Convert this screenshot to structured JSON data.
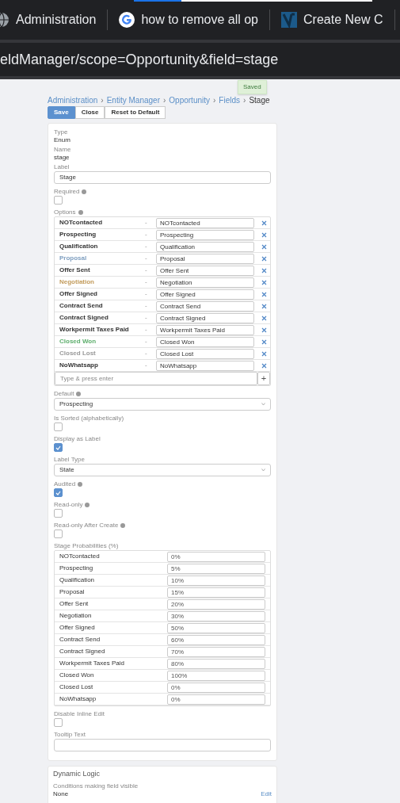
{
  "browser": {
    "tabs": [
      {
        "title": "Administration",
        "kind": "globe"
      },
      {
        "title": "how to remove all op",
        "kind": "google"
      },
      {
        "title": "Create New C",
        "kind": "logo"
      }
    ],
    "address": "eldManager/scope=Opportunity&field=stage"
  },
  "notification": "Saved",
  "breadcrumb": {
    "separator": "›",
    "items": [
      "Administration",
      "Entity Manager",
      "Opportunity",
      "Fields",
      "Stage"
    ]
  },
  "buttons": [
    {
      "label": "Save",
      "kind": "primary"
    },
    {
      "label": "Close",
      "kind": "default"
    },
    {
      "label": "Reset to Default",
      "kind": "default"
    }
  ],
  "fields": [
    {
      "kind": "static",
      "label": "Type",
      "value": "Enum"
    },
    {
      "kind": "static",
      "label": "Name",
      "value": "stage"
    },
    {
      "kind": "text",
      "label": "Label",
      "value": "Stage"
    },
    {
      "kind": "checkbox",
      "label": "Required",
      "info": true,
      "checked": false
    },
    {
      "kind": "options",
      "label": "Options",
      "info": true,
      "separator": "-",
      "placeholder": "Type & press enter",
      "add": "+",
      "items": [
        {
          "label": "NOTcontacted",
          "value": "NOTcontacted",
          "color": "#333333"
        },
        {
          "label": "Prospecting",
          "value": "Prospecting",
          "color": "#333333"
        },
        {
          "label": "Qualification",
          "value": "Qualification",
          "color": "#333333"
        },
        {
          "label": "Proposal",
          "value": "Proposal",
          "color": "#7f9fc0"
        },
        {
          "label": "Offer Sent",
          "value": "Offer Sent",
          "color": "#333333"
        },
        {
          "label": "Negotiation",
          "value": "Negotiation",
          "color": "#c29b5b"
        },
        {
          "label": "Offer Signed",
          "value": "Offer Signed",
          "color": "#333333"
        },
        {
          "label": "Contract Send",
          "value": "Contract Send",
          "color": "#333333"
        },
        {
          "label": "Contract Signed",
          "value": "Contract Signed",
          "color": "#333333"
        },
        {
          "label": "Workpermit Taxes Paid",
          "value": "Workpermit Taxes Paid",
          "color": "#333333"
        },
        {
          "label": "Closed Won",
          "value": "Closed Won",
          "color": "#5dae6c"
        },
        {
          "label": "Closed Lost",
          "value": "Closed Lost",
          "color": "#999999"
        },
        {
          "label": "NoWhatsapp",
          "value": "NoWhatsapp",
          "color": "#333333"
        }
      ]
    },
    {
      "kind": "select",
      "label": "Default",
      "info": true,
      "value": "Prospecting"
    },
    {
      "kind": "checkbox",
      "label": "Is Sorted (alphabetically)",
      "info": false,
      "checked": false
    },
    {
      "kind": "checkbox",
      "label": "Display as Label",
      "info": false,
      "checked": true
    },
    {
      "kind": "select",
      "label": "Label Type",
      "info": false,
      "value": "State"
    },
    {
      "kind": "checkbox",
      "label": "Audited",
      "info": true,
      "checked": true
    },
    {
      "kind": "checkbox",
      "label": "Read-only",
      "info": true,
      "checked": false
    },
    {
      "kind": "checkbox",
      "label": "Read-only After Create",
      "info": true,
      "checked": false
    },
    {
      "kind": "probabilities",
      "label": "Stage Probabilities (%)",
      "rows": [
        {
          "label": "NOTcontacted",
          "value": "0%"
        },
        {
          "label": "Prospecting",
          "value": "5%"
        },
        {
          "label": "Qualification",
          "value": "10%"
        },
        {
          "label": "Proposal",
          "value": "15%"
        },
        {
          "label": "Offer Sent",
          "value": "20%"
        },
        {
          "label": "Negotiation",
          "value": "30%"
        },
        {
          "label": "Offer Signed",
          "value": "50%"
        },
        {
          "label": "Contract Send",
          "value": "60%"
        },
        {
          "label": "Contract Signed",
          "value": "70%"
        },
        {
          "label": "Workpermit Taxes Paid",
          "value": "80%"
        },
        {
          "label": "Closed Won",
          "value": "100%"
        },
        {
          "label": "Closed Lost",
          "value": "0%"
        },
        {
          "label": "NoWhatsapp",
          "value": "0%"
        }
      ]
    },
    {
      "kind": "checkbox",
      "label": "Disable Inline Edit",
      "info": false,
      "checked": false
    },
    {
      "kind": "text",
      "label": "Tooltip Text"
    }
  ],
  "dynamic_logic": {
    "title": "Dynamic Logic",
    "items": [
      {
        "label": "Conditions making field visible",
        "value": "None",
        "action": "Edit"
      }
    ]
  }
}
